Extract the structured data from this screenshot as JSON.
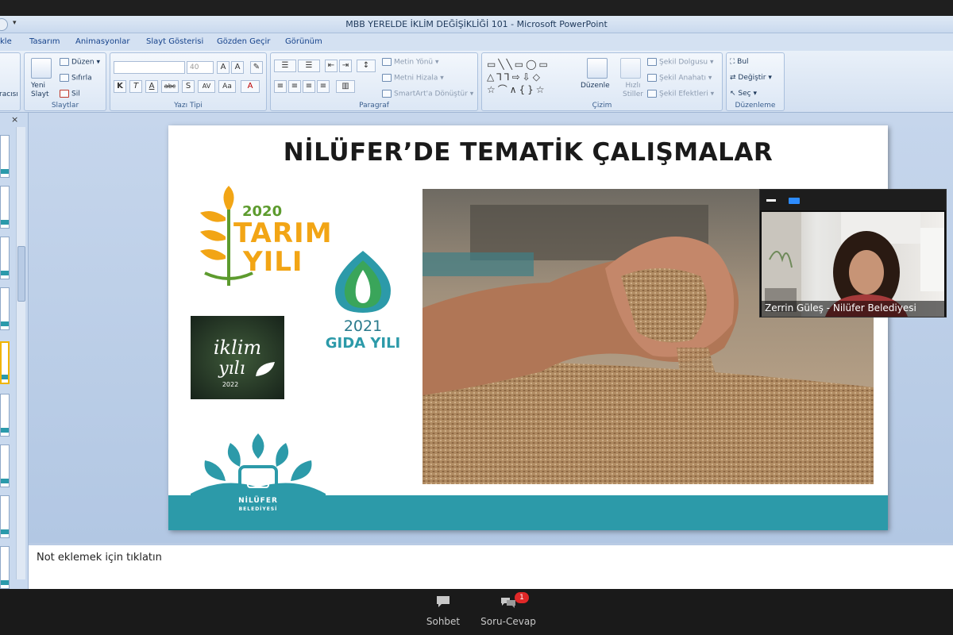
{
  "window": {
    "title": "MBB YERELDE İKLİM DEĞİŞİKLİĞİ 101 - Microsoft PowerPoint"
  },
  "tabs": [
    "kle",
    "Tasarım",
    "Animasyonlar",
    "Slayt Gösterisi",
    "Gözden Geçir",
    "Görünüm"
  ],
  "ribbon": {
    "leftcut": "racısı",
    "slides_group": {
      "label": "Slaytlar",
      "new_slide": "Yeni Slayt",
      "layout": "Düzen",
      "reset": "Sıfırla",
      "delete": "Sil"
    },
    "font_group": {
      "label": "Yazı Tipi",
      "font_size": "40",
      "bold": "K",
      "italic": "T",
      "underline": "A",
      "strike": "abc",
      "shadow": "S",
      "spacing": "AV",
      "case": "Aa"
    },
    "paragraph_group": {
      "label": "Paragraf",
      "text_direction": "Metin Yönü",
      "align_text": "Metni Hizala",
      "smartart": "SmartArt'a Dönüştür"
    },
    "drawing_group": {
      "label": "Çizim",
      "arrange": "Düzenle",
      "quick_styles": "Hızlı Stiller",
      "shape_fill": "Şekil Dolgusu",
      "shape_outline": "Şekil Anahatı",
      "shape_effects": "Şekil Efektleri"
    },
    "editing_group": {
      "label": "Düzenleme",
      "find": "Bul",
      "replace": "Değiştir",
      "select": "Seç"
    }
  },
  "slide": {
    "title": "NİLÜFER’DE TEMATİK ÇALIŞMALAR",
    "tarim_logo": {
      "year": "2020",
      "word1": "TARIM",
      "word2": "YILI"
    },
    "iklim_logo": {
      "line1": "iklim",
      "line2": "yılı",
      "year": "2022"
    },
    "gida_logo": {
      "year": "2021",
      "word": "GIDA YILI"
    },
    "nilufer_logo": {
      "name": "NİLÜFER",
      "sub": "BELEDİYESİ"
    }
  },
  "webcam": {
    "participant": "Zerrin Güleş - Nilüfer Belediyesi"
  },
  "notes": {
    "placeholder": "Not eklemek için tıklatın"
  },
  "zoom": {
    "chat_label": "Sohbet",
    "qa_label": "Soru-Cevap",
    "qa_badge": "1"
  },
  "colors": {
    "teal": "#2c9aa9",
    "tarim_orange": "#f2a515",
    "tarim_green": "#5d9b2e",
    "zoom_blue": "#2d8cff",
    "badge_red": "#e02828"
  }
}
